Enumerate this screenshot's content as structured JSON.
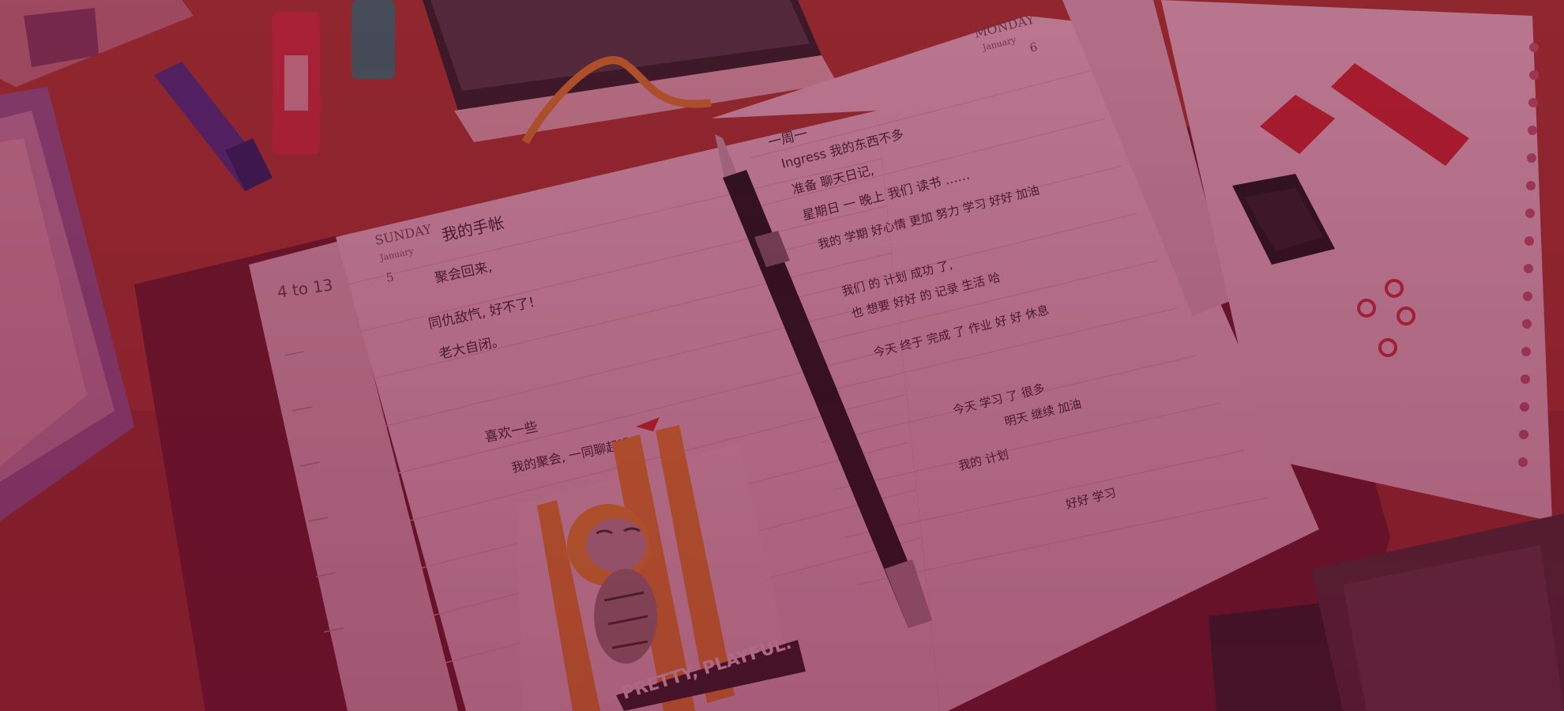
{
  "scene": {
    "left_page": {
      "day": "SUNDAY",
      "month": "January",
      "date": "5",
      "handwriting": [
        "我的手帐",
        "聚会回来,",
        "同仇敌忾, 好不了!",
        "老大自闭。",
        "喜欢一些",
        "我的聚会, 一同聊起哦。"
      ]
    },
    "right_page": {
      "day": "MONDAY",
      "month": "January",
      "date": "6",
      "handwriting": [
        "一周一",
        "Ingress 我的东西不多",
        "准备 聊天日记,",
        "星期日 一 晚上 我们 读书 ……",
        "我的 学期 好心情 更加 努力 学习 好好 加油",
        "我们 的 计划 成功 了,",
        "也 想要 好好 的 记录 生活 哈",
        "今天 终于 完成 了 作业 好 好 休息",
        "今天 学习 了 很多",
        "明天 继续 加油",
        "我的 计划",
        "好好 学习"
      ]
    },
    "side_strip": {
      "date_text": "4 to 13"
    },
    "sticker_text": "PRETTY, PLAYFUL."
  }
}
